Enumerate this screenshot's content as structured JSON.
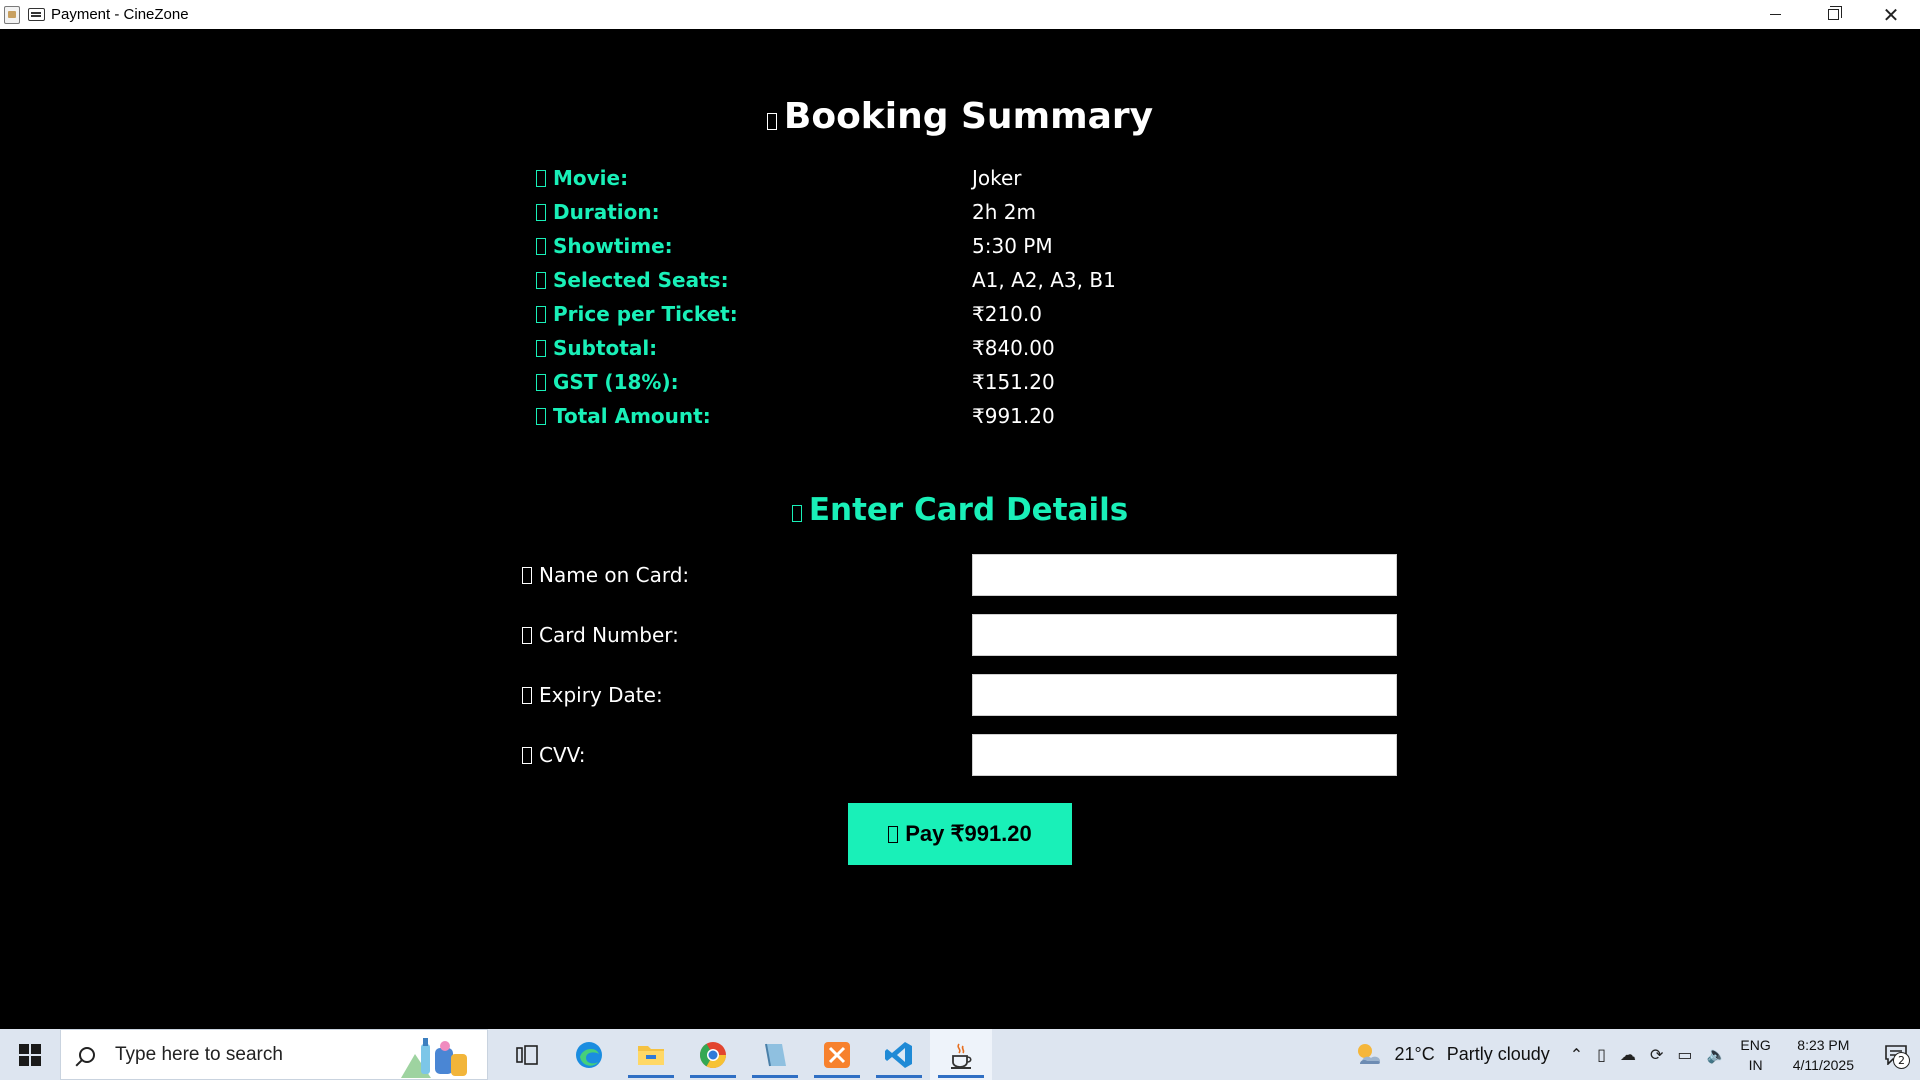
{
  "window": {
    "title": "Payment - CineZone"
  },
  "summary": {
    "heading": "Booking Summary",
    "rows": [
      {
        "label": "Movie:",
        "value": "Joker"
      },
      {
        "label": "Duration:",
        "value": "2h 2m"
      },
      {
        "label": "Showtime:",
        "value": "5:30 PM"
      },
      {
        "label": "Selected Seats:",
        "value": "A1, A2, A3, B1"
      },
      {
        "label": "Price per Ticket:",
        "value": "₹210.0"
      },
      {
        "label": "Subtotal:",
        "value": "₹840.00"
      },
      {
        "label": "GST (18%):",
        "value": "₹151.20"
      },
      {
        "label": "Total Amount:",
        "value": "₹991.20"
      }
    ]
  },
  "card": {
    "heading": "Enter Card Details",
    "fields": [
      {
        "label": "Name on Card:",
        "value": ""
      },
      {
        "label": "Card Number:",
        "value": ""
      },
      {
        "label": "Expiry Date:",
        "value": ""
      },
      {
        "label": "CVV:",
        "value": ""
      }
    ],
    "pay_label": "Pay ₹991.20"
  },
  "taskbar": {
    "search_placeholder": "Type here to search",
    "weather_temp": "21°C",
    "weather_text": "Partly cloudy",
    "lang_top": "ENG",
    "lang_bottom": "IN",
    "time": "8:23 PM",
    "date": "4/11/2025",
    "notification_count": "2",
    "apps": [
      "task-view",
      "edge",
      "file-explorer",
      "chrome",
      "notepad",
      "xampp",
      "vscode",
      "java"
    ]
  },
  "colors": {
    "accent": "#19f0b8",
    "background": "#000000",
    "text": "#ffffff",
    "taskbar": "#dde5f0"
  }
}
